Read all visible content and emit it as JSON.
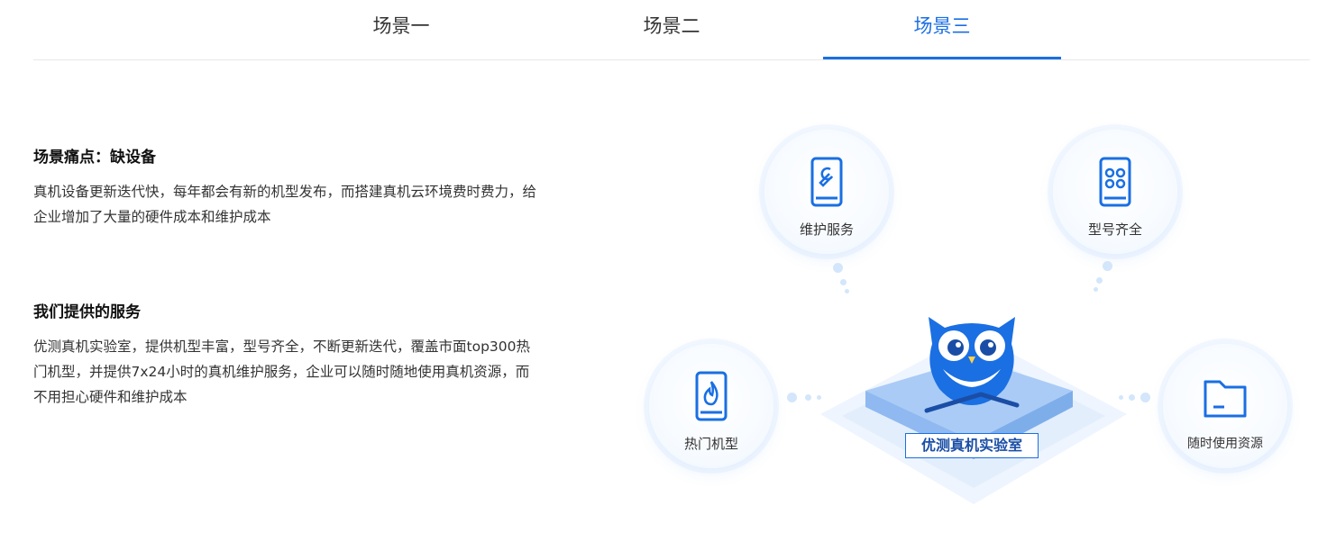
{
  "tabs": [
    {
      "label": "场景一",
      "active": false
    },
    {
      "label": "场景二",
      "active": false
    },
    {
      "label": "场景三",
      "active": true
    }
  ],
  "pain": {
    "title": "场景痛点：缺设备",
    "text": "真机设备更新迭代快，每年都会有新的机型发布，而搭建真机云环境费时费力，给企业增加了大量的硬件成本和维护成本"
  },
  "service": {
    "title": "我们提供的服务",
    "text": "优测真机实验室，提供机型丰富，型号齐全，不断更新迭代，覆盖市面top300热门机型，并提供7x24小时的真机维护服务，企业可以随时随地使用真机资源，而不用担心硬件和维护成本"
  },
  "illustration": {
    "center_label": "优测真机实验室",
    "features": [
      {
        "label": "维护服务",
        "icon": "wrench-phone-icon"
      },
      {
        "label": "型号齐全",
        "icon": "apps-phone-icon"
      },
      {
        "label": "热门机型",
        "icon": "flame-phone-icon"
      },
      {
        "label": "随时使用资源",
        "icon": "folder-icon"
      }
    ]
  },
  "colors": {
    "accent": "#1a6fe3",
    "light": "#d3e6fb"
  }
}
